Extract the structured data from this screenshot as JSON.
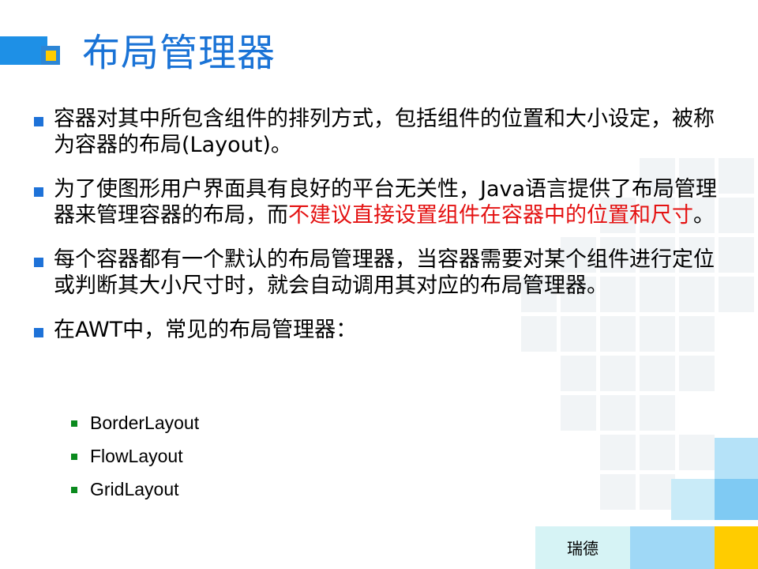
{
  "slide": {
    "title": "布局管理器",
    "bullets": [
      {
        "text": "容器对其中所包含组件的排列方式，包括组件的位置和大小设定，被称为容器的布局(Layout)。"
      },
      {
        "text": "为了使图形用户界面具有良好的平台无关性，Java语言提供了布局管理器来管理容器的布局，而",
        "highlight": "不建议直接设置组件在容器中的位置和尺寸",
        "tail": "。"
      },
      {
        "text": "每个容器都有一个默认的布局管理器，当容器需要对某个组件进行定位或判断其大小尺寸时，就会自动调用其对应的布局管理器。"
      },
      {
        "text": "在AWT中，常见的布局管理器："
      }
    ],
    "sub_items": [
      "BorderLayout",
      "FlowLayout",
      "GridLayout"
    ],
    "footer_label": "瑞德"
  },
  "colors": {
    "title": "#1a73d6",
    "bullet_marker": "#1e72d8",
    "sub_marker": "#0a8a1e",
    "highlight": "#e41212",
    "accent_yellow": "#ffcc00",
    "accent_blue": "#1e90e6"
  }
}
